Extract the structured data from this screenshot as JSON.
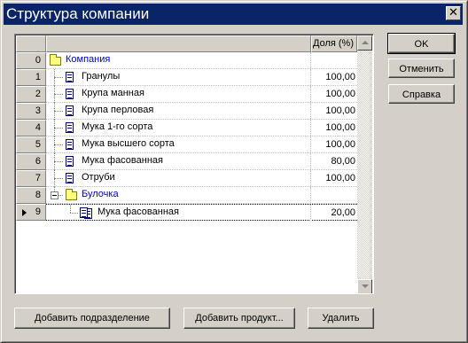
{
  "window": {
    "title": "Структура компании",
    "close_glyph": "✕"
  },
  "grid": {
    "share_header": "Доля (%)",
    "rows": [
      {
        "num": "0",
        "name": "Компания",
        "share": "",
        "kind": "folder",
        "level": 0,
        "color": "blue"
      },
      {
        "num": "1",
        "name": "Гранулы",
        "share": "100,00",
        "kind": "doc",
        "level": 1
      },
      {
        "num": "2",
        "name": "Крупа манная",
        "share": "100,00",
        "kind": "doc",
        "level": 1
      },
      {
        "num": "3",
        "name": "Крупа перловая",
        "share": "100,00",
        "kind": "doc",
        "level": 1
      },
      {
        "num": "4",
        "name": "Мука 1-го сорта",
        "share": "100,00",
        "kind": "doc",
        "level": 1
      },
      {
        "num": "5",
        "name": "Мука высшего сорта",
        "share": "100,00",
        "kind": "doc",
        "level": 1
      },
      {
        "num": "6",
        "name": "Мука фасованная",
        "share": "80,00",
        "kind": "doc",
        "level": 1
      },
      {
        "num": "7",
        "name": "Отруби",
        "share": "100,00",
        "kind": "doc",
        "level": 1
      },
      {
        "num": "8",
        "name": "Булочка",
        "share": "",
        "kind": "folder-open",
        "level": 1,
        "color": "blue"
      },
      {
        "num": "9",
        "name": "Мука фасованная",
        "share": "20,00",
        "kind": "doc-multi",
        "level": 2,
        "selected": true
      }
    ]
  },
  "side_buttons": {
    "ok": "OK",
    "cancel": "Отменить",
    "help": "Справка"
  },
  "bottom_buttons": {
    "add_division": "Добавить подразделение",
    "add_product": "Добавить продукт...",
    "delete": "Удалить"
  },
  "colors": {
    "titlebar": "#0a246a",
    "face": "#d4d0c8",
    "link_text": "#0000cc"
  }
}
